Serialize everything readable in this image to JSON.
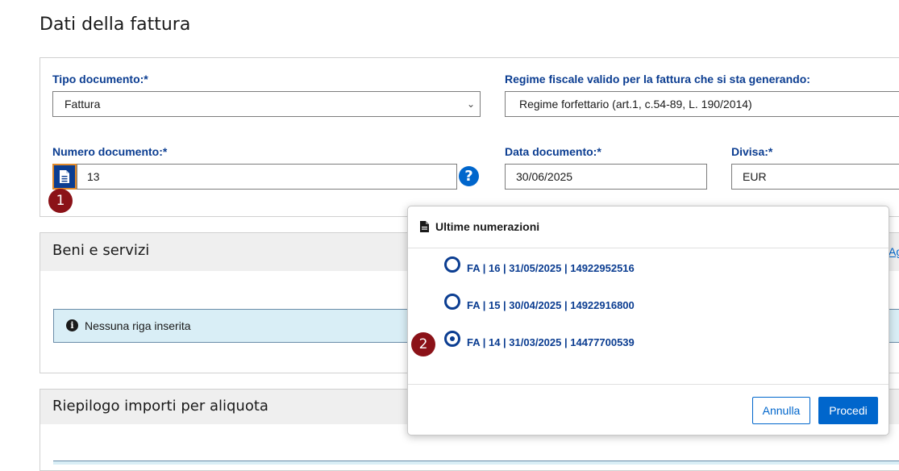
{
  "page": {
    "title": "Dati della fattura"
  },
  "form": {
    "tipo_documento": {
      "label": "Tipo documento:*",
      "value": "Fattura"
    },
    "regime_fiscale": {
      "label": "Regime fiscale valido per la fattura che si sta generando:",
      "value": "Regime forfettario (art.1, c.54-89, L. 190/2014)"
    },
    "numero_documento": {
      "label": "Numero documento:*",
      "value": "13"
    },
    "data_documento": {
      "label": "Data documento:*",
      "value": "30/06/2025"
    },
    "divisa": {
      "label": "Divisa:*",
      "value": "EUR"
    },
    "help_glyph": "?"
  },
  "badges": {
    "step1": "1",
    "step2": "2"
  },
  "beni_servizi": {
    "title": "Beni e servizi",
    "alert": "Nessuna riga inserita",
    "right_link": "Ag"
  },
  "riepilogo": {
    "title": "Riepilogo importi per aliquota"
  },
  "modal": {
    "title": "Ultime numerazioni",
    "options": [
      {
        "label": "FA | 16 | 31/05/2025 | 14922952516",
        "checked": false
      },
      {
        "label": "FA | 15 | 30/04/2025 | 14922916800",
        "checked": false
      },
      {
        "label": "FA | 14 | 31/03/2025 | 14477700539",
        "checked": true
      }
    ],
    "cancel_label": "Annulla",
    "proceed_label": "Procedi"
  },
  "icons": {
    "document_button": "file-lines-icon",
    "help": "question-circle-icon",
    "info": "info-circle-icon",
    "modal_header": "file-icon",
    "select_chevron": "chevron-down-icon"
  },
  "colors": {
    "primary": "#0066cc",
    "label_blue": "#0b3d91",
    "badge_red": "#8b1218",
    "focus_orange": "#e08a2c",
    "alert_bg": "#d9eef6"
  }
}
